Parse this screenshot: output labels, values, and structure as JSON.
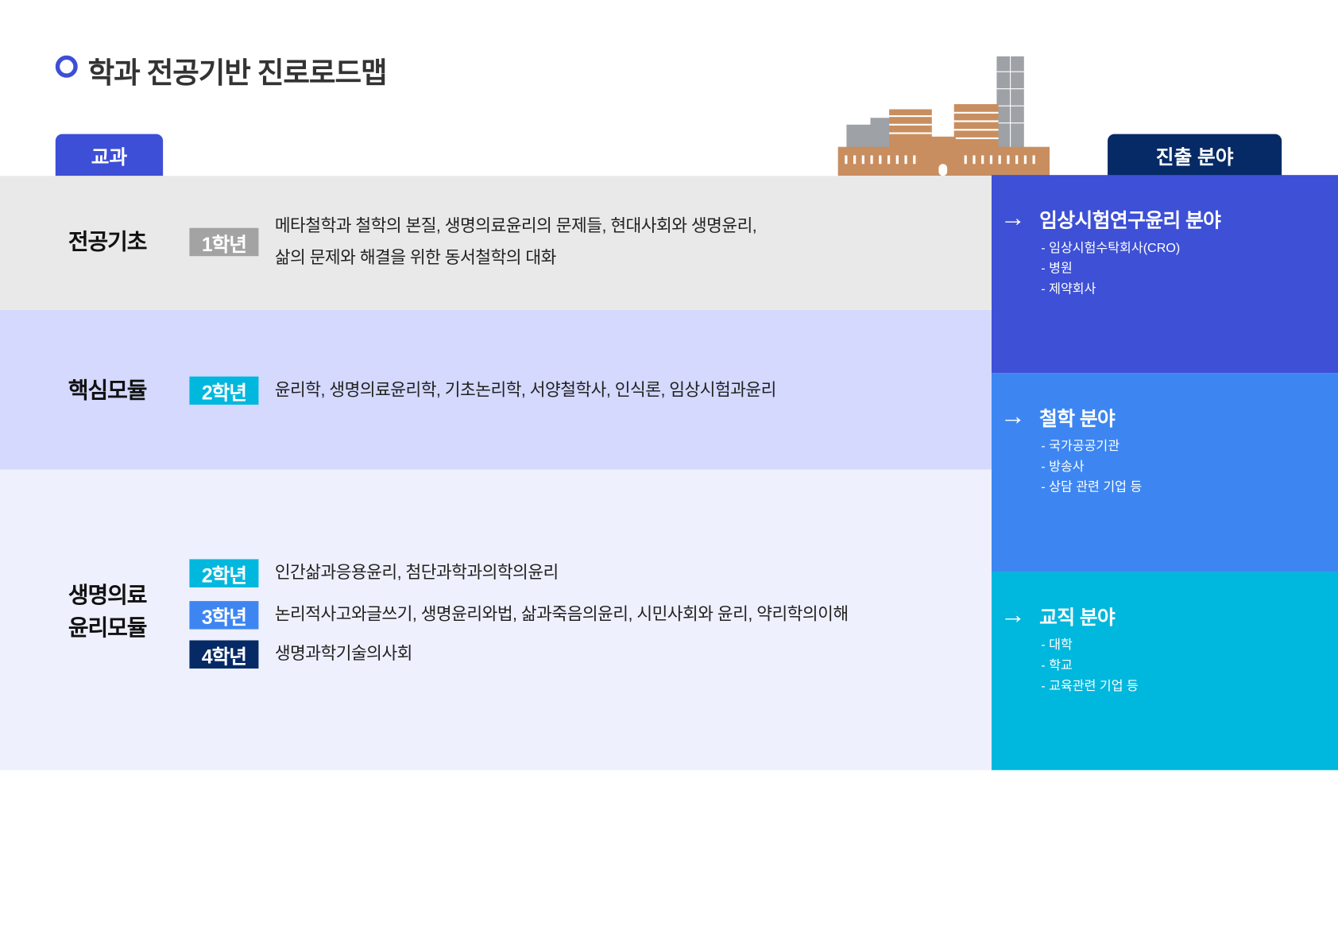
{
  "title": "학과 전공기반 진로로드맵",
  "tabs": {
    "left": "교과",
    "right": "진출 분야"
  },
  "modules": [
    {
      "label": "전공기초",
      "courses": [
        {
          "grade": "1학년",
          "color": "#a3a3a3",
          "lines": [
            "메타철학과 철학의 본질, 생명의료윤리의 문제들, 현대사회와 생명윤리,",
            "삶의 문제와 해결을 위한 동서철학의 대화"
          ]
        }
      ]
    },
    {
      "label": "핵심모듈",
      "courses": [
        {
          "grade": "2학년",
          "color": "#00b7dd",
          "lines": [
            "윤리학, 생명의료윤리학, 기초논리학, 서양철학사, 인식론, 임상시험과윤리"
          ]
        }
      ]
    },
    {
      "label_lines": [
        "생명의료",
        "윤리모듈"
      ],
      "courses": [
        {
          "grade": "2학년",
          "color": "#00b7dd",
          "lines": [
            "인간삶과응용윤리, 첨단과학과의학의윤리"
          ]
        },
        {
          "grade": "3학년",
          "color": "#3d86f2",
          "lines": [
            "논리적사고와글쓰기, 생명윤리와법, 삶과죽음의윤리, 시민사회와 윤리, 약리학의이해"
          ]
        },
        {
          "grade": "4학년",
          "color": "#062a66",
          "lines": [
            "생명과학기술의사회"
          ]
        }
      ]
    }
  ],
  "careers": [
    {
      "title": "임상시험연구윤리 분야",
      "color": "#3d50d6",
      "items": [
        "- 임상시험수탁회사(CRO)",
        "- 병원",
        "- 제약회사"
      ]
    },
    {
      "title": "철학 분야",
      "color": "#3d86f2",
      "items": [
        "- 국가공공기관",
        "- 방송사",
        "- 상담 관련 기업 등"
      ]
    },
    {
      "title": "교직 분야",
      "color": "#00b7dd",
      "items": [
        "- 대학",
        "- 학교",
        "- 교육관련 기업 등"
      ]
    }
  ],
  "icons": {
    "arrow": "→"
  }
}
